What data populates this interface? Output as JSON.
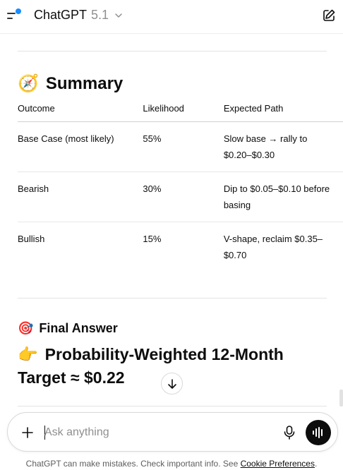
{
  "header": {
    "title": "ChatGPT",
    "version": "5.1",
    "menu_icon": "sidebar-menu-icon",
    "new_chat_icon": "edit-icon"
  },
  "summary": {
    "emoji": "🧭",
    "title": "Summary",
    "columns": [
      "Outcome",
      "Likelihood",
      "Expected Path"
    ],
    "rows": [
      {
        "outcome": "Base Case (most likely)",
        "likelihood": "55%",
        "path_line1": "Slow base → rally to",
        "path_line2": "$0.20–$0.30"
      },
      {
        "outcome": "Bearish",
        "likelihood": "30%",
        "path_line1": "Dip to $0.05–$0.10 before",
        "path_line2": "basing"
      },
      {
        "outcome": "Bullish",
        "likelihood": "15%",
        "path_line1": "V-shape, reclaim $0.35–",
        "path_line2": "$0.70"
      }
    ]
  },
  "final": {
    "emoji": "🎯",
    "title": "Final Answer",
    "headline_emoji": "👉",
    "headline_line1": "Probability-Weighted 12-Month",
    "headline_line2": "Target ≈ $0.22"
  },
  "composer": {
    "placeholder": "Ask anything"
  },
  "footer": {
    "disclaimer": "ChatGPT can make mistakes. Check important info. See",
    "link": "Cookie Preferences",
    "period": "."
  },
  "colors": {
    "accent_dot": "#1a8cff",
    "text": "#0d0d0d",
    "muted": "#8f8f8f"
  }
}
